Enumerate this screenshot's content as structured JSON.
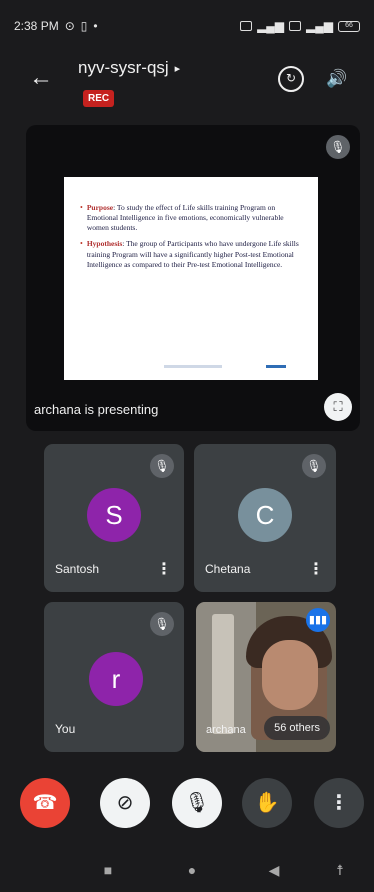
{
  "status_bar": {
    "time": "2:38 PM",
    "battery": "66"
  },
  "header": {
    "back_icon": "arrow-left-icon",
    "meeting_code": "nyv-sysr-qsj",
    "rec_label": "REC",
    "switch_camera_icon": "switch-camera-icon",
    "audio_icon": "speaker-icon"
  },
  "presentation": {
    "presenting_text": "archana is presenting",
    "slide": {
      "items": [
        {
          "key": "Purpose",
          "text": ": To study the effect of Life skills training Program on Emotional Intelligence in five emotions, economically vulnerable women students."
        },
        {
          "key": "Hypothesis",
          "text": ": The group of Participants who have undergone Life skills training Program will have a significantly higher Post-test Emotional Intelligence as compared to their Pre-test Emotional Intelligence."
        }
      ]
    }
  },
  "participants": [
    {
      "name": "Santosh",
      "initial": "S",
      "avatar_color": "#8e24aa",
      "muted": true
    },
    {
      "name": "Chetana",
      "initial": "C",
      "avatar_color": "#78909c",
      "muted": true
    },
    {
      "name": "You",
      "initial": "r",
      "avatar_color": "#8e24aa",
      "muted": true
    },
    {
      "name": "archana",
      "video": true,
      "speaking": true
    }
  ],
  "others_label": "56 others",
  "controls": {
    "end_call_icon": "phone-hangup-icon",
    "camera_icon": "camera-off-icon",
    "mic_icon": "mic-off-icon",
    "hand_icon": "raise-hand-icon",
    "more_icon": "more-vert-icon"
  },
  "colors": {
    "background": "#1b1b1d",
    "tile": "#3c4043",
    "end_call": "#ea4335",
    "rec": "#c5221f",
    "speaking": "#1a73e8"
  }
}
